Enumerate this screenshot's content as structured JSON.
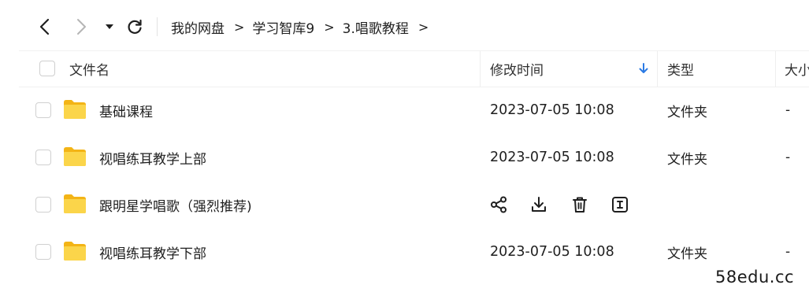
{
  "navigation": {
    "back_icon": "chevron-left-icon",
    "forward_icon": "chevron-right-icon",
    "history_icon": "caret-down-icon",
    "refresh_icon": "refresh-icon",
    "breadcrumb": {
      "items": [
        "我的网盘",
        "学习智库9",
        "3.唱歌教程"
      ],
      "separator": ">"
    }
  },
  "table": {
    "columns": {
      "name": "文件名",
      "modified": "修改时间",
      "type": "类型",
      "size": "大小"
    },
    "sort": {
      "column": "modified",
      "direction": "descending",
      "icon": "arrow-down-icon",
      "color": "#2b7ae4"
    },
    "rows": [
      {
        "name": "基础课程",
        "modified": "2023-07-05 10:08",
        "type": "文件夹",
        "size": "-",
        "icon": "folder-icon"
      },
      {
        "name": "视唱练耳教学上部",
        "modified": "2023-07-05 10:08",
        "type": "文件夹",
        "size": "-",
        "icon": "folder-icon"
      },
      {
        "name": "跟明星学唱歌（强烈推荐)",
        "modified": "",
        "type": "",
        "size": "",
        "icon": "folder-icon",
        "hovered": true,
        "actions": [
          "share-icon",
          "download-icon",
          "delete-icon",
          "rename-icon"
        ]
      },
      {
        "name": "视唱练耳教学下部",
        "modified": "2023-07-05 10:08",
        "type": "文件夹",
        "size": "-",
        "icon": "folder-icon"
      }
    ]
  },
  "colors": {
    "folder": "#f9c51d",
    "accent": "#2b7ae4"
  },
  "watermark": "58edu.cc"
}
